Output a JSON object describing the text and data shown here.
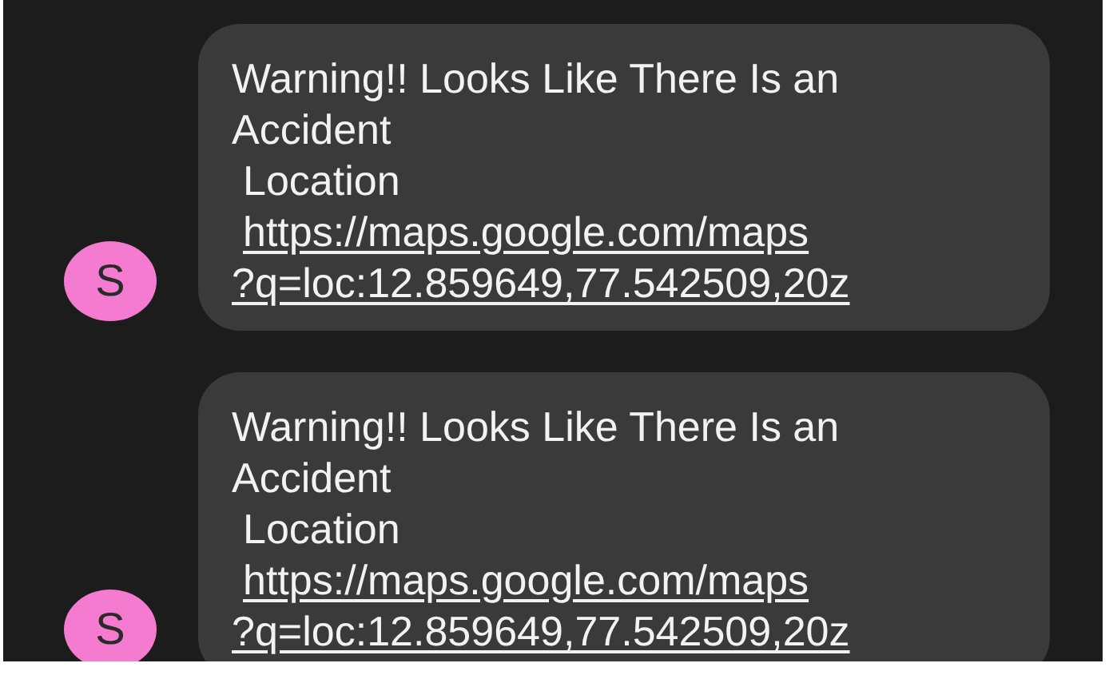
{
  "messages": [
    {
      "sender_initial": "S",
      "text": "Warning!! Looks Like There Is an Accident",
      "location_label": "Location",
      "link_lines": [
        "https://maps.google.com/maps",
        "?q=loc:12.859649,77.542509,20z"
      ]
    },
    {
      "sender_initial": "S",
      "text": "Warning!! Looks Like There Is an Accident",
      "location_label": "Location",
      "link_lines": [
        "https://maps.google.com/maps",
        "?q=loc:12.859649,77.542509,20z"
      ]
    }
  ]
}
